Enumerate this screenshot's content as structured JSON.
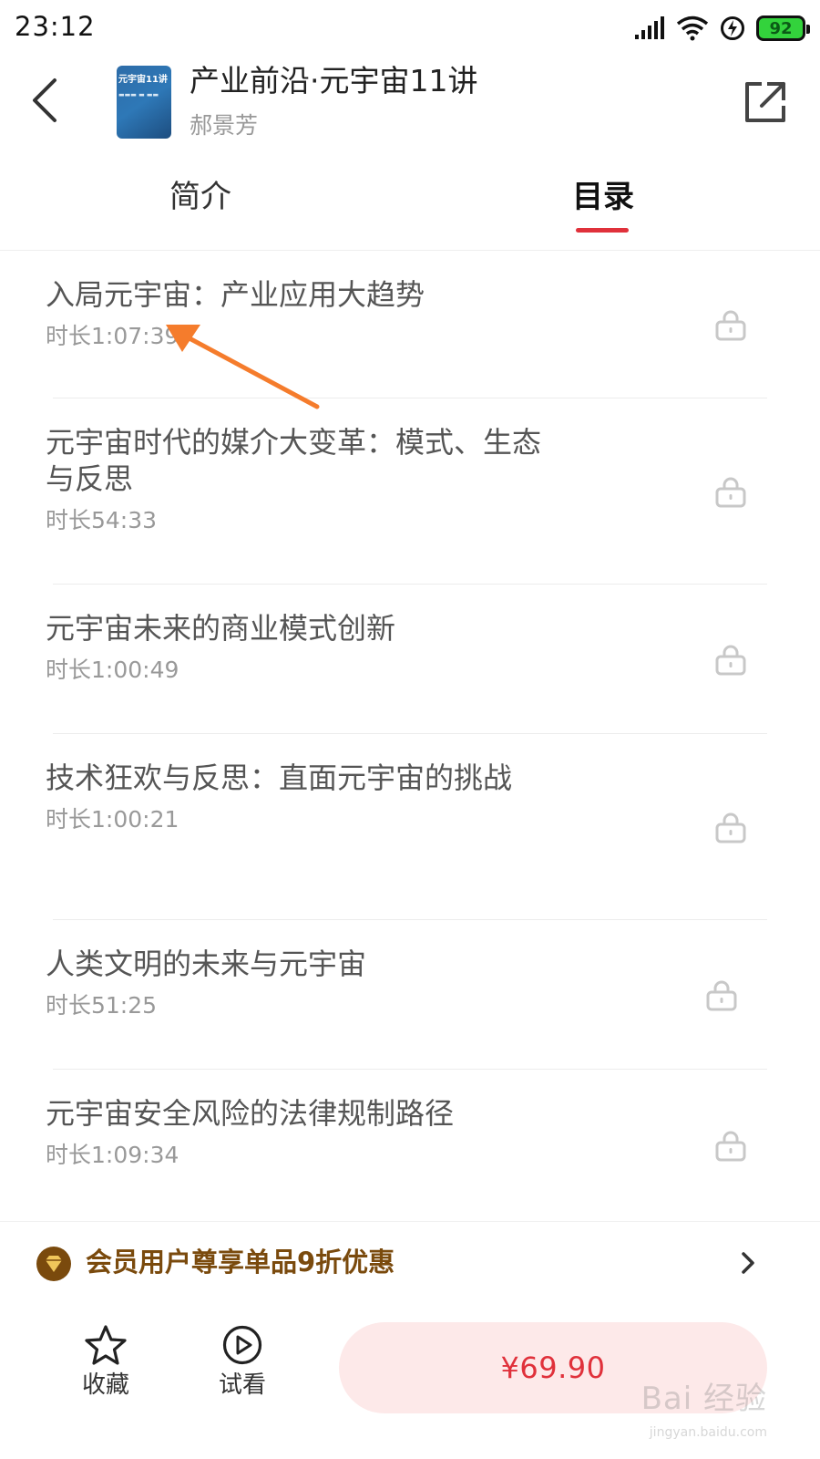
{
  "status_bar": {
    "time": "23:12",
    "battery": "92"
  },
  "header": {
    "title": "产业前沿·元宇宙11讲",
    "author": "郝景芳",
    "cover_title": "元宇宙11讲"
  },
  "tabs": {
    "intro": "简介",
    "catalog": "目录"
  },
  "lessons": [
    {
      "title": "入局元宇宙：产业应用大趋势",
      "duration": "时长1:07:39"
    },
    {
      "title": "元宇宙时代的媒介大变革：模式、生态与反思",
      "duration": "时长54:33"
    },
    {
      "title": "元宇宙未来的商业模式创新",
      "duration": "时长1:00:49"
    },
    {
      "title": "技术狂欢与反思：直面元宇宙的挑战",
      "duration": "时长1:00:21"
    },
    {
      "title": "人类文明的未来与元宇宙",
      "duration": "时长51:25"
    },
    {
      "title": "元宇宙安全风险的法律规制路径",
      "duration": "时长1:09:34"
    }
  ],
  "vip": {
    "text": "会员用户尊享单品9折优惠"
  },
  "bottom": {
    "favorite": "收藏",
    "preview": "试看",
    "price": "¥69.90"
  },
  "watermark": {
    "main": "Bai 经验",
    "sub": "jingyan.baidu.com"
  },
  "colors": {
    "accent": "#e0313b",
    "vip_brown": "#7a4a0d",
    "buy_bg": "#fde9e9",
    "annotation_arrow": "#f57c2c"
  }
}
